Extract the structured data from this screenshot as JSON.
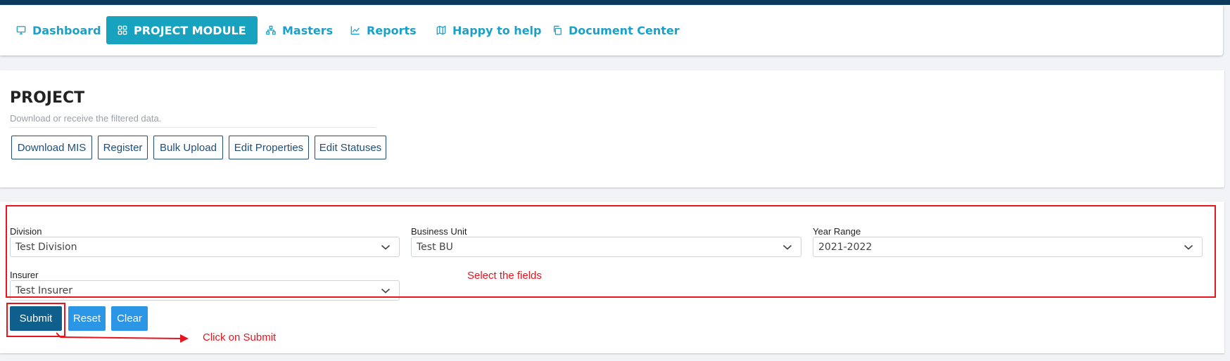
{
  "nav": {
    "items": [
      {
        "label": "Dashboard",
        "icon": "monitor-icon"
      },
      {
        "label": "PROJECT MODULE",
        "icon": "grid-icon",
        "active": true
      },
      {
        "label": "Masters",
        "icon": "hierarchy-icon"
      },
      {
        "label": "Reports",
        "icon": "line-chart-icon"
      },
      {
        "label": "Happy to help",
        "icon": "map-icon"
      },
      {
        "label": "Document Center",
        "icon": "copy-icon"
      }
    ]
  },
  "page": {
    "title": "PROJECT",
    "subtitle": "Download or receive the filtered data."
  },
  "actions": {
    "download_mis": "Download MIS",
    "register": "Register",
    "bulk_upload": "Bulk Upload",
    "edit_properties": "Edit Properties",
    "edit_statuses": "Edit Statuses"
  },
  "filters": {
    "division": {
      "label": "Division",
      "value": "Test Division"
    },
    "business_unit": {
      "label": "Business Unit",
      "value": "Test BU"
    },
    "year_range": {
      "label": "Year Range",
      "value": "2021-2022"
    },
    "insurer": {
      "label": "Insurer",
      "value": "Test Insurer"
    }
  },
  "form_buttons": {
    "submit": "Submit",
    "reset": "Reset",
    "clear": "Clear"
  },
  "annotations": {
    "fields_note": "Select the fields",
    "submit_note": "Click on Submit"
  },
  "colors": {
    "nav_text": "#1ba1c9",
    "nav_active_bg": "#17a2c0",
    "outline_button": "#1f4e79",
    "submit_bg": "#0f5f8c",
    "secondary_bg": "#2b95e6",
    "annotation": "#e8141e",
    "topbar": "#0b3a5e"
  }
}
